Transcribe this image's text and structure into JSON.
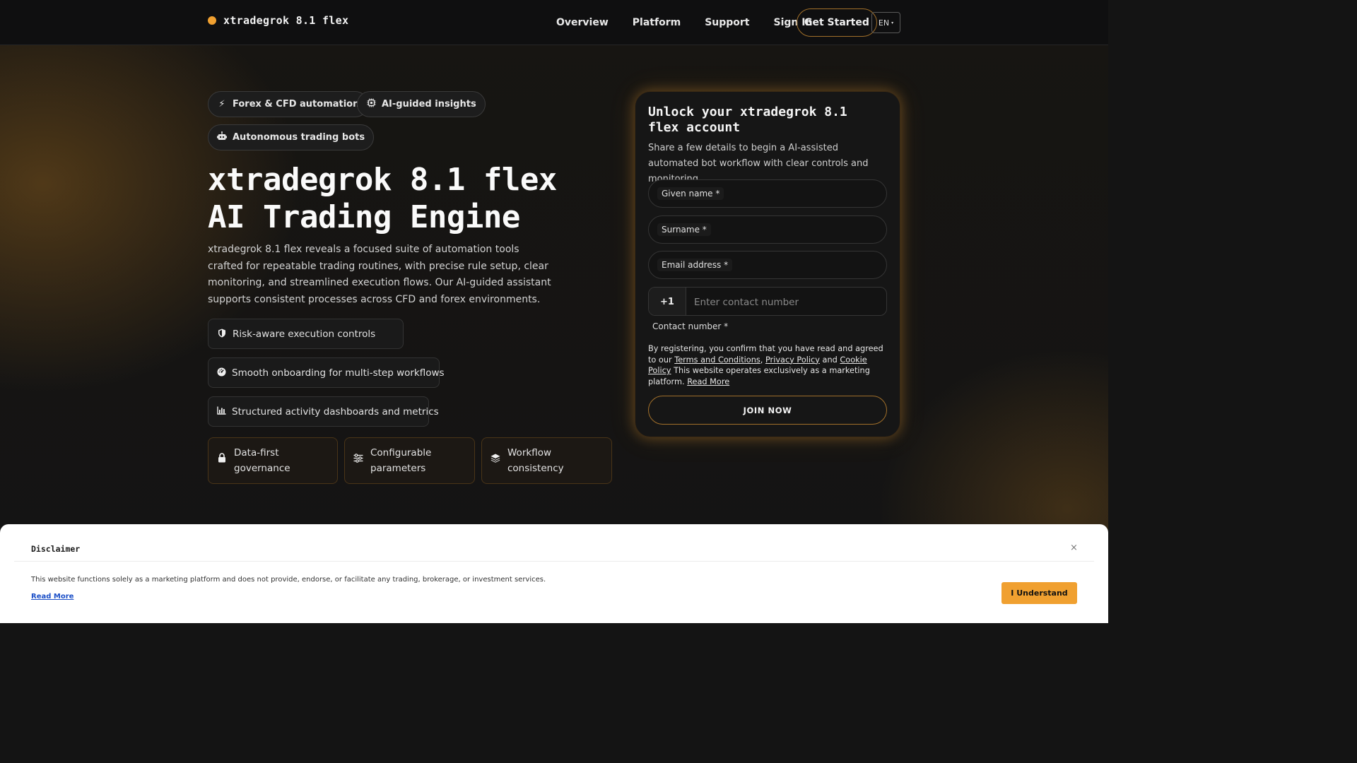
{
  "header": {
    "brand": "xtradegrok 8.1 flex",
    "nav": [
      "Overview",
      "Platform",
      "Support",
      "Sign In"
    ],
    "cta": "Get Started",
    "language": "EN"
  },
  "hero": {
    "chips": [
      {
        "label": "Forex & CFD automation",
        "icon": "bolt-icon"
      },
      {
        "label": "AI-guided insights",
        "icon": "chip-icon"
      },
      {
        "label": "Autonomous trading bots",
        "icon": "robot-icon"
      }
    ],
    "title": "xtradegrok 8.1 flex AI Trading Engine",
    "description": "xtradegrok 8.1 flex reveals a focused suite of automation tools crafted for repeatable trading routines, with precise rule setup, clear monitoring, and streamlined execution flows. Our AI-guided assistant supports consistent processes across CFD and forex environments.",
    "features": [
      {
        "label": "Risk-aware execution controls",
        "icon": "shield-icon"
      },
      {
        "label": "Smooth onboarding for multi-step workflows",
        "icon": "gauge-icon"
      },
      {
        "label": "Structured activity dashboards and metrics",
        "icon": "bar-chart-icon"
      }
    ],
    "cards": [
      {
        "label": "Data-first governance",
        "icon": "lock-icon"
      },
      {
        "label": "Configurable parameters",
        "icon": "sliders-icon"
      },
      {
        "label": "Workflow consistency",
        "icon": "layers-icon"
      }
    ]
  },
  "form": {
    "title": "Unlock your xtradegrok 8.1 flex account",
    "subtitle": "Share a few details to begin a AI-assisted automated bot workflow with clear controls and monitoring.",
    "given_name": "Given name *",
    "surname": "Surname *",
    "email": "Email address *",
    "phone_code": "+1",
    "phone_placeholder": "Enter contact number",
    "phone_label": "Contact number *",
    "consent_prefix": "By registering, you confirm that you have read and agreed to our",
    "terms": "Terms and Conditions",
    "privacy": "Privacy Policy",
    "and": "and",
    "cookie": "Cookie Policy",
    "consent_suffix": "This website operates exclusively as a marketing platform.",
    "read_more": "Read More",
    "submit": "JOIN NOW"
  },
  "disclaimer": {
    "title": "Disclaimer",
    "close": "×",
    "text": "This website functions solely as a marketing platform and does not provide, endorse, or facilitate any trading, brokerage, or investment services.",
    "read_more": "Read More",
    "button": "I Understand"
  },
  "colors": {
    "accent": "#f0a030",
    "background": "#141414",
    "link": "#1b4fc7"
  }
}
